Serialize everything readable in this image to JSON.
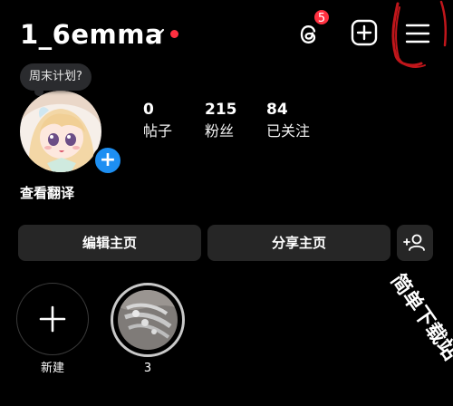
{
  "header": {
    "username": "1_6emma",
    "threads_badge": "5",
    "accent_color": "#ff3040"
  },
  "note": {
    "text": "周末计划?"
  },
  "stats": [
    {
      "value": "0",
      "label": "帖子"
    },
    {
      "value": "215",
      "label": "粉丝"
    },
    {
      "value": "84",
      "label": "已关注"
    }
  ],
  "bio": {
    "translate_label": "查看翻译"
  },
  "actions": {
    "edit_label": "编辑主页",
    "share_label": "分享主页",
    "add_person_icon": "add-person-icon"
  },
  "highlights": [
    {
      "label": "新建",
      "kind": "new"
    },
    {
      "label": "3",
      "kind": "image"
    }
  ],
  "watermark": {
    "text": "简单下载站"
  },
  "icons": {
    "chevron": "chevron-down-icon",
    "threads": "threads-icon",
    "create": "plus-square-icon",
    "menu": "hamburger-menu-icon"
  }
}
